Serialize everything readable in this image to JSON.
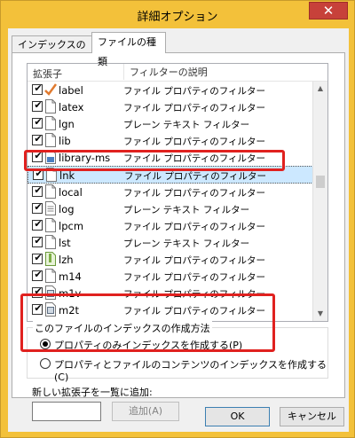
{
  "window": {
    "title": "詳細オプション",
    "close_glyph": "✕"
  },
  "tabs": [
    {
      "label": "インデックスの設定",
      "active": false
    },
    {
      "label": "ファイルの種類",
      "active": true
    }
  ],
  "list": {
    "col_ext": "拡張子",
    "col_filter": "フィルターの説明",
    "rows": [
      {
        "ext": "label",
        "filter": "ファイル プロパティのフィルター",
        "checked": true,
        "icon": "checkmark-file-icon"
      },
      {
        "ext": "latex",
        "filter": "ファイル プロパティのフィルター",
        "checked": true,
        "icon": "file-icon"
      },
      {
        "ext": "lgn",
        "filter": "プレーン テキスト フィルター",
        "checked": true,
        "icon": "file-icon"
      },
      {
        "ext": "lib",
        "filter": "ファイル プロパティのフィルター",
        "checked": true,
        "icon": "file-icon"
      },
      {
        "ext": "library-ms",
        "filter": "ファイル プロパティのフィルター",
        "checked": true,
        "icon": "library-icon"
      },
      {
        "ext": "lnk",
        "filter": "ファイル プロパティのフィルター",
        "checked": true,
        "icon": "file-icon",
        "selected": true
      },
      {
        "ext": "local",
        "filter": "ファイル プロパティのフィルター",
        "checked": true,
        "icon": "file-icon"
      },
      {
        "ext": "log",
        "filter": "プレーン テキスト フィルター",
        "checked": true,
        "icon": "text-file-icon"
      },
      {
        "ext": "lpcm",
        "filter": "ファイル プロパティのフィルター",
        "checked": true,
        "icon": "file-icon"
      },
      {
        "ext": "lst",
        "filter": "プレーン テキスト フィルター",
        "checked": true,
        "icon": "file-icon"
      },
      {
        "ext": "lzh",
        "filter": "ファイル プロパティのフィルター",
        "checked": true,
        "icon": "archive-icon"
      },
      {
        "ext": "m14",
        "filter": "ファイル プロパティのフィルター",
        "checked": true,
        "icon": "file-icon"
      },
      {
        "ext": "m1v",
        "filter": "ファイル プロパティのフィルター",
        "checked": true,
        "icon": "video-file-icon"
      },
      {
        "ext": "m2t",
        "filter": "ファイル プロパティのフィルター",
        "checked": true,
        "icon": "video-file-icon"
      }
    ]
  },
  "index_method": {
    "label": "このファイルのインデックスの作成方法",
    "options": [
      {
        "label": "プロパティのみインデックスを作成する(P)",
        "selected": true
      },
      {
        "label": "プロパティとファイルのコンテンツのインデックスを作成する(C)",
        "selected": false
      }
    ]
  },
  "add": {
    "label": "新しい拡張子を一覧に追加:",
    "value": "",
    "button": "追加(A)"
  },
  "buttons": {
    "ok": "OK",
    "cancel": "キャンセル"
  },
  "colors": {
    "titlebar": "#f3c13a",
    "close": "#c7413a",
    "highlight": "#e0211f",
    "selection": "#cce8ff"
  }
}
